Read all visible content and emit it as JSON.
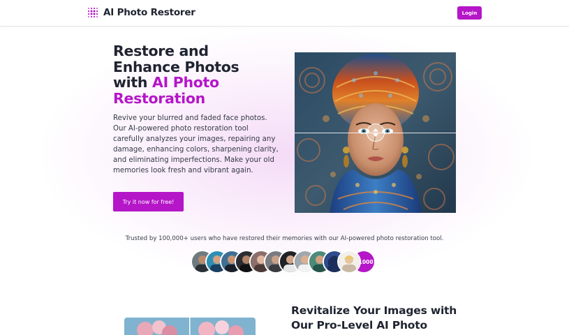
{
  "header": {
    "app_name": "AI Photo Restorer",
    "logo_icon": "dotted-grid-icon",
    "login_label": "Login"
  },
  "hero": {
    "title_line1": "Restore and",
    "title_line2": "Enhance Photos",
    "title_line3_prefix": "with ",
    "title_accent_line3": "AI Photo",
    "title_accent_line4": "Restoration",
    "description": "Revive your blurred and faded face photos. Our AI-powered photo restoration tool carefully analyzes your images, repairing any damage, enhancing colors, sharpening clarity, and eliminating imperfections. Make your old memories look fresh and vibrant again.",
    "cta_label": "Try it now for free!",
    "compare_handle_icon": "up-down-arrows-icon"
  },
  "trust": {
    "text": "Trusted by 100,000+ users who have restored their memories with our AI-powered photo restoration tool.",
    "more_count": "+1000"
  },
  "section2": {
    "title_line1": "Revitalize Your Images with",
    "title_line2": "Our Pro-Level AI Photo"
  },
  "colors": {
    "accent": "#b516c8",
    "text": "#1f2430"
  }
}
